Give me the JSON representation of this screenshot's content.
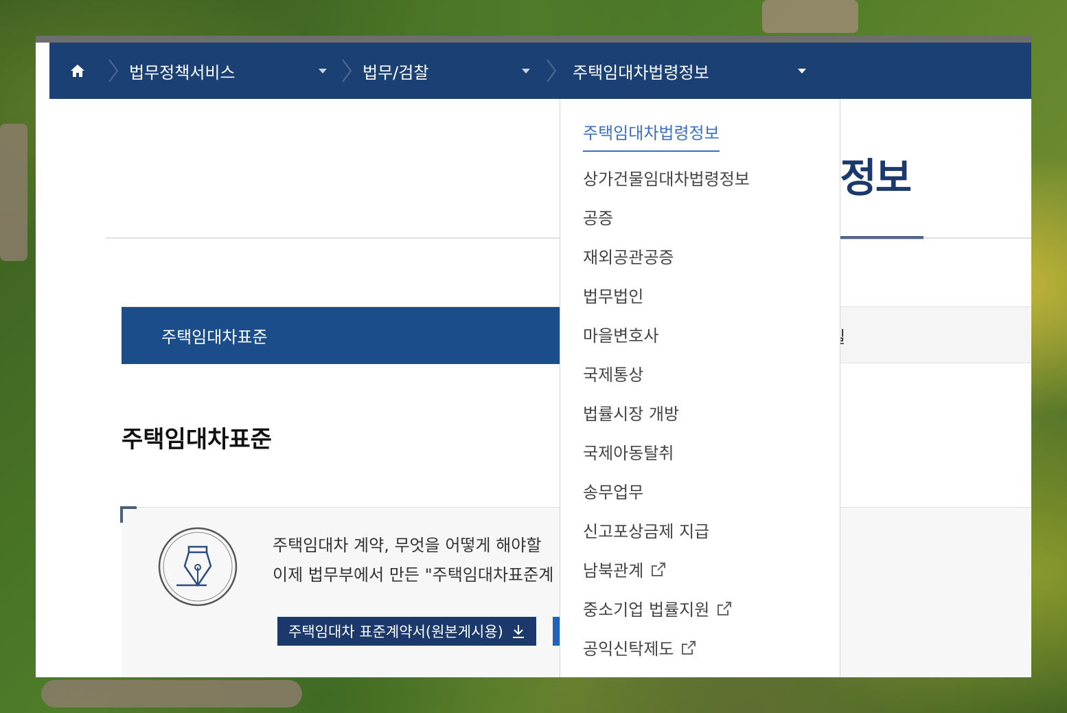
{
  "breadcrumb": {
    "home_icon": "home-icon",
    "items": [
      {
        "label": "법무정책서비스"
      },
      {
        "label": "법무/검찰"
      },
      {
        "label": "주택임대차법령정보"
      }
    ]
  },
  "page": {
    "title_fragment": "령정보",
    "tabs": [
      {
        "label": "주택임대차표준",
        "active": true
      },
      {
        "label": "료실",
        "active": false
      }
    ],
    "section_heading": "주택임대차표준",
    "info": {
      "line1": "주택임대차 계약, 무엇을 어떻게 해야할",
      "line2": "이제 법무부에서 만든 \"주택임대차표준계",
      "icon": "fountain-pen-icon",
      "download_button": "주택임대차 표준계약서(원본게시용)",
      "download_icon": "download-icon"
    }
  },
  "dropdown": {
    "items": [
      {
        "label": "주택임대차법령정보",
        "selected": true,
        "external": false
      },
      {
        "label": "상가건물임대차법령정보",
        "selected": false,
        "external": false
      },
      {
        "label": "공증",
        "selected": false,
        "external": false
      },
      {
        "label": "재외공관공증",
        "selected": false,
        "external": false
      },
      {
        "label": "법무법인",
        "selected": false,
        "external": false
      },
      {
        "label": "마을변호사",
        "selected": false,
        "external": false
      },
      {
        "label": "국제통상",
        "selected": false,
        "external": false
      },
      {
        "label": "법률시장 개방",
        "selected": false,
        "external": false
      },
      {
        "label": "국제아동탈취",
        "selected": false,
        "external": false
      },
      {
        "label": "송무업무",
        "selected": false,
        "external": false
      },
      {
        "label": "신고포상금제 지급",
        "selected": false,
        "external": false
      },
      {
        "label": "남북관계",
        "selected": false,
        "external": true
      },
      {
        "label": "중소기업 법률지원",
        "selected": false,
        "external": true
      },
      {
        "label": "공익신탁제도",
        "selected": false,
        "external": true
      }
    ],
    "external_icon": "external-link-icon"
  },
  "colors": {
    "navbar": "#1b4174",
    "active_tab": "#1b4d8a",
    "dropdown_selected": "#3a6fc7",
    "title": "#1b3a6b"
  }
}
